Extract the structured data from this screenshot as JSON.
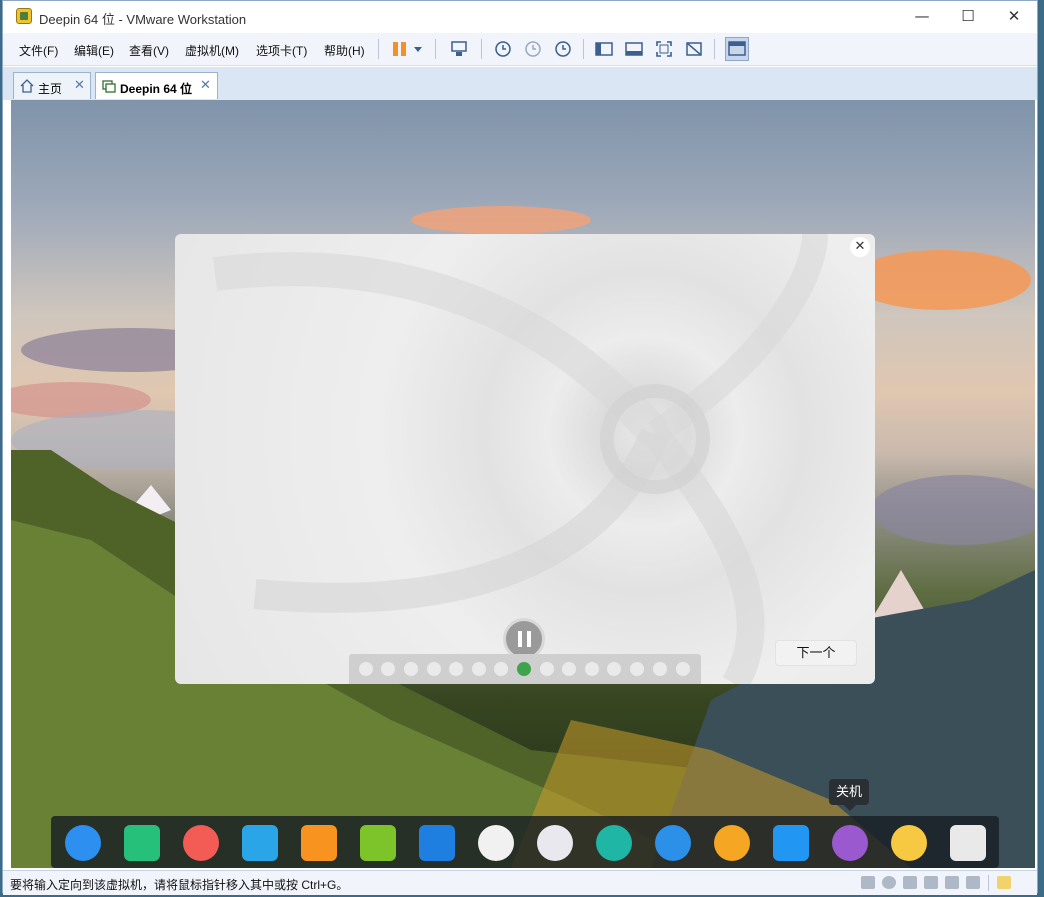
{
  "window": {
    "title": "Deepin 64 位 - VMware Workstation",
    "controls": {
      "minimize": "—",
      "maximize": "☐",
      "close": "✕"
    }
  },
  "menubar": {
    "items": [
      "文件(F)",
      "编辑(E)",
      "查看(V)",
      "虚拟机(M)",
      "选项卡(T)",
      "帮助(H)"
    ]
  },
  "tabs": [
    {
      "label": "主页",
      "close": "✕"
    },
    {
      "label": "Deepin 64 位",
      "close": "✕"
    }
  ],
  "dialog": {
    "close": "✕",
    "next_button": "下一个"
  },
  "tooltip": "关机",
  "dock": {
    "icons": [
      "launcher-icon",
      "terminal-icon",
      "screen-recorder-icon",
      "file-manager-icon",
      "app-store-icon",
      "music-icon",
      "video-icon",
      "chrome-icon",
      "settings-icon",
      "handshake-icon",
      "keyboard-icon",
      "browser-icon",
      "screenshot-icon",
      "power-icon",
      "clock-icon",
      "trash-icon"
    ],
    "colors": [
      "#2d8ff0",
      "#27c07a",
      "#f25c54",
      "#2aa6e8",
      "#f7931e",
      "#7cc42a",
      "#1e7fe0",
      "#f1f1f1",
      "#e8e8ee",
      "#1fb6a6",
      "#2c8fe8",
      "#f5a623",
      "#2196f3",
      "#9b59d0",
      "#f7c842",
      "#e9e9e9"
    ]
  },
  "statusbar": {
    "text": "要将输入定向到该虚拟机，请将鼠标指针移入其中或按 Ctrl+G。"
  }
}
